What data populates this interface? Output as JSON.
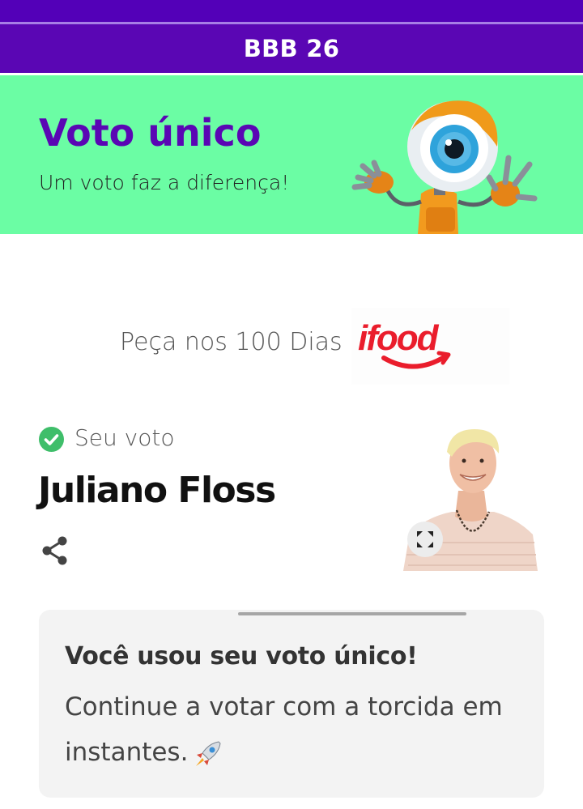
{
  "header": {
    "title": "BBB 26"
  },
  "hero": {
    "title": "Voto único",
    "subtitle": "Um voto faz a diferença!",
    "mascot": "big-eye-robot-mascot"
  },
  "sponsor": {
    "text": "Peça nos 100 Dias",
    "logo_text": "ifood"
  },
  "vote": {
    "label": "Seu voto",
    "name": "Juliano Floss",
    "status_icon": "check-circle-icon",
    "share_icon": "share-icon",
    "expand_icon": "expand-icon"
  },
  "card": {
    "title": "Você usou seu voto único!",
    "body": "Continue a votar com a torcida em instantes.",
    "emoji": "rocket-icon"
  },
  "colors": {
    "brand_purple": "#5a06b4",
    "hero_green": "#6bfda4",
    "check_green": "#3fbe6a",
    "ifood_red": "#ea1d2c"
  }
}
